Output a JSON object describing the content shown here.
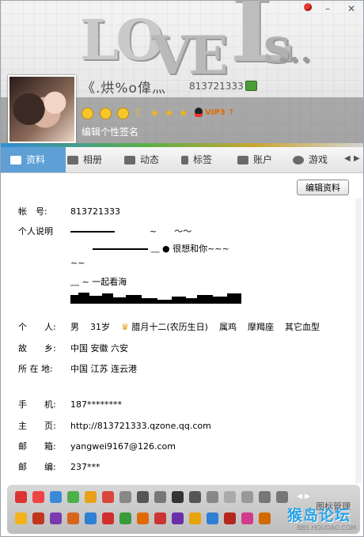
{
  "header": {
    "banner_text": "LOVE Ls...",
    "nickname": "《.烘%o偉灬",
    "qq_number": "813721333",
    "vip_label": "VIP3",
    "signature": "编辑个性签名"
  },
  "tabs": [
    {
      "label": "资料"
    },
    {
      "label": "相册"
    },
    {
      "label": "动态"
    },
    {
      "label": "标签"
    },
    {
      "label": "账户"
    },
    {
      "label": "游戏"
    }
  ],
  "edit_button": "编辑资料",
  "profile": {
    "account": {
      "label": "帐　号:",
      "value": "813721333"
    },
    "intro_label": "个人说明",
    "intro_lines": [
      "~　　～～",
      "﹏ ● 很想和你~~~",
      "~~",
      "﹏ ~ 一起看海"
    ],
    "personal": {
      "label": "个　　人:",
      "gender": "男",
      "age": "31岁",
      "birthday": "腊月十二(农历生日)",
      "zodiac": "属鸡",
      "constellation": "摩羯座",
      "blood": "其它血型"
    },
    "hometown": {
      "label": "故　　乡:",
      "value": "中国 安徽 六安"
    },
    "location": {
      "label": "所 在 地:",
      "value": "中国 江苏 连云港"
    },
    "phone": {
      "label": "手　　机:",
      "value": "187********"
    },
    "homepage": {
      "label": "主　　页:",
      "value": "http://813721333.qzone.qq.com"
    },
    "email": {
      "label": "邮　　箱:",
      "value": "yangwei9167@126.com"
    },
    "postcode": {
      "label": "邮　　编:",
      "value": "237***"
    }
  },
  "iconbar": {
    "label": "图标管理",
    "row1_colors": [
      "#d33",
      "#e44",
      "#3a8ad8",
      "#4cb04a",
      "#e9a11a",
      "#d9483b",
      "#888",
      "#555",
      "#777",
      "#333",
      "#555",
      "#888",
      "#aaa",
      "#999",
      "#777",
      "#777"
    ],
    "row2_colors": [
      "#f3b21a",
      "#c2361d",
      "#7a3bb0",
      "#d9641a",
      "#2f7fd3",
      "#d12f2f",
      "#3a9b3a",
      "#e06a00",
      "#c33",
      "#6b2da8",
      "#e7a30a",
      "#2f7fd3",
      "#b4271d",
      "#d13b8b",
      "#d26a00"
    ]
  },
  "watermark": {
    "main": "猴岛论坛",
    "sub": "BBS.HOUDAO.COM"
  },
  "colors": {
    "accent_tab": "#5e9fd6",
    "vip": "#e46b00"
  }
}
